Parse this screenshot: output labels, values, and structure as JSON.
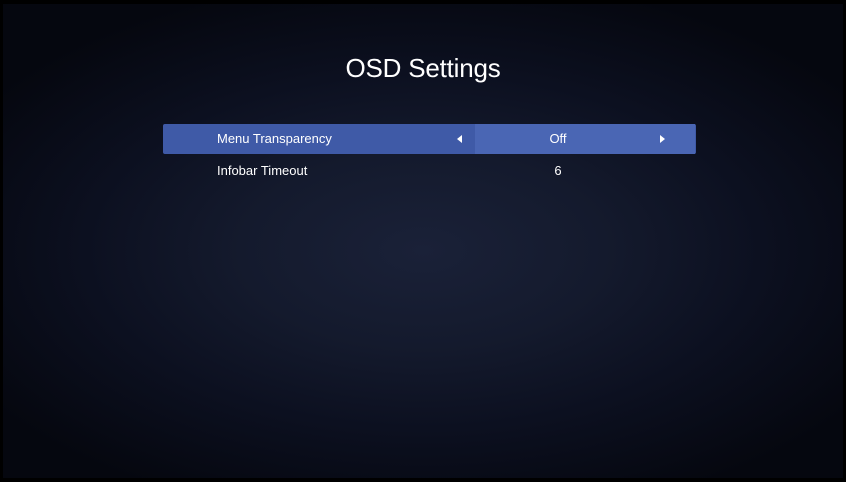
{
  "page": {
    "title": "OSD Settings"
  },
  "settings": [
    {
      "label": "Menu Transparency",
      "value": "Off",
      "selected": true
    },
    {
      "label": "Infobar Timeout",
      "value": "6",
      "selected": false
    }
  ],
  "icons": {
    "left": "arrow-left-icon",
    "right": "arrow-right-icon"
  },
  "colors": {
    "selection": "#3f5aa7",
    "background": "#141a2d",
    "text": "#ffffff"
  }
}
